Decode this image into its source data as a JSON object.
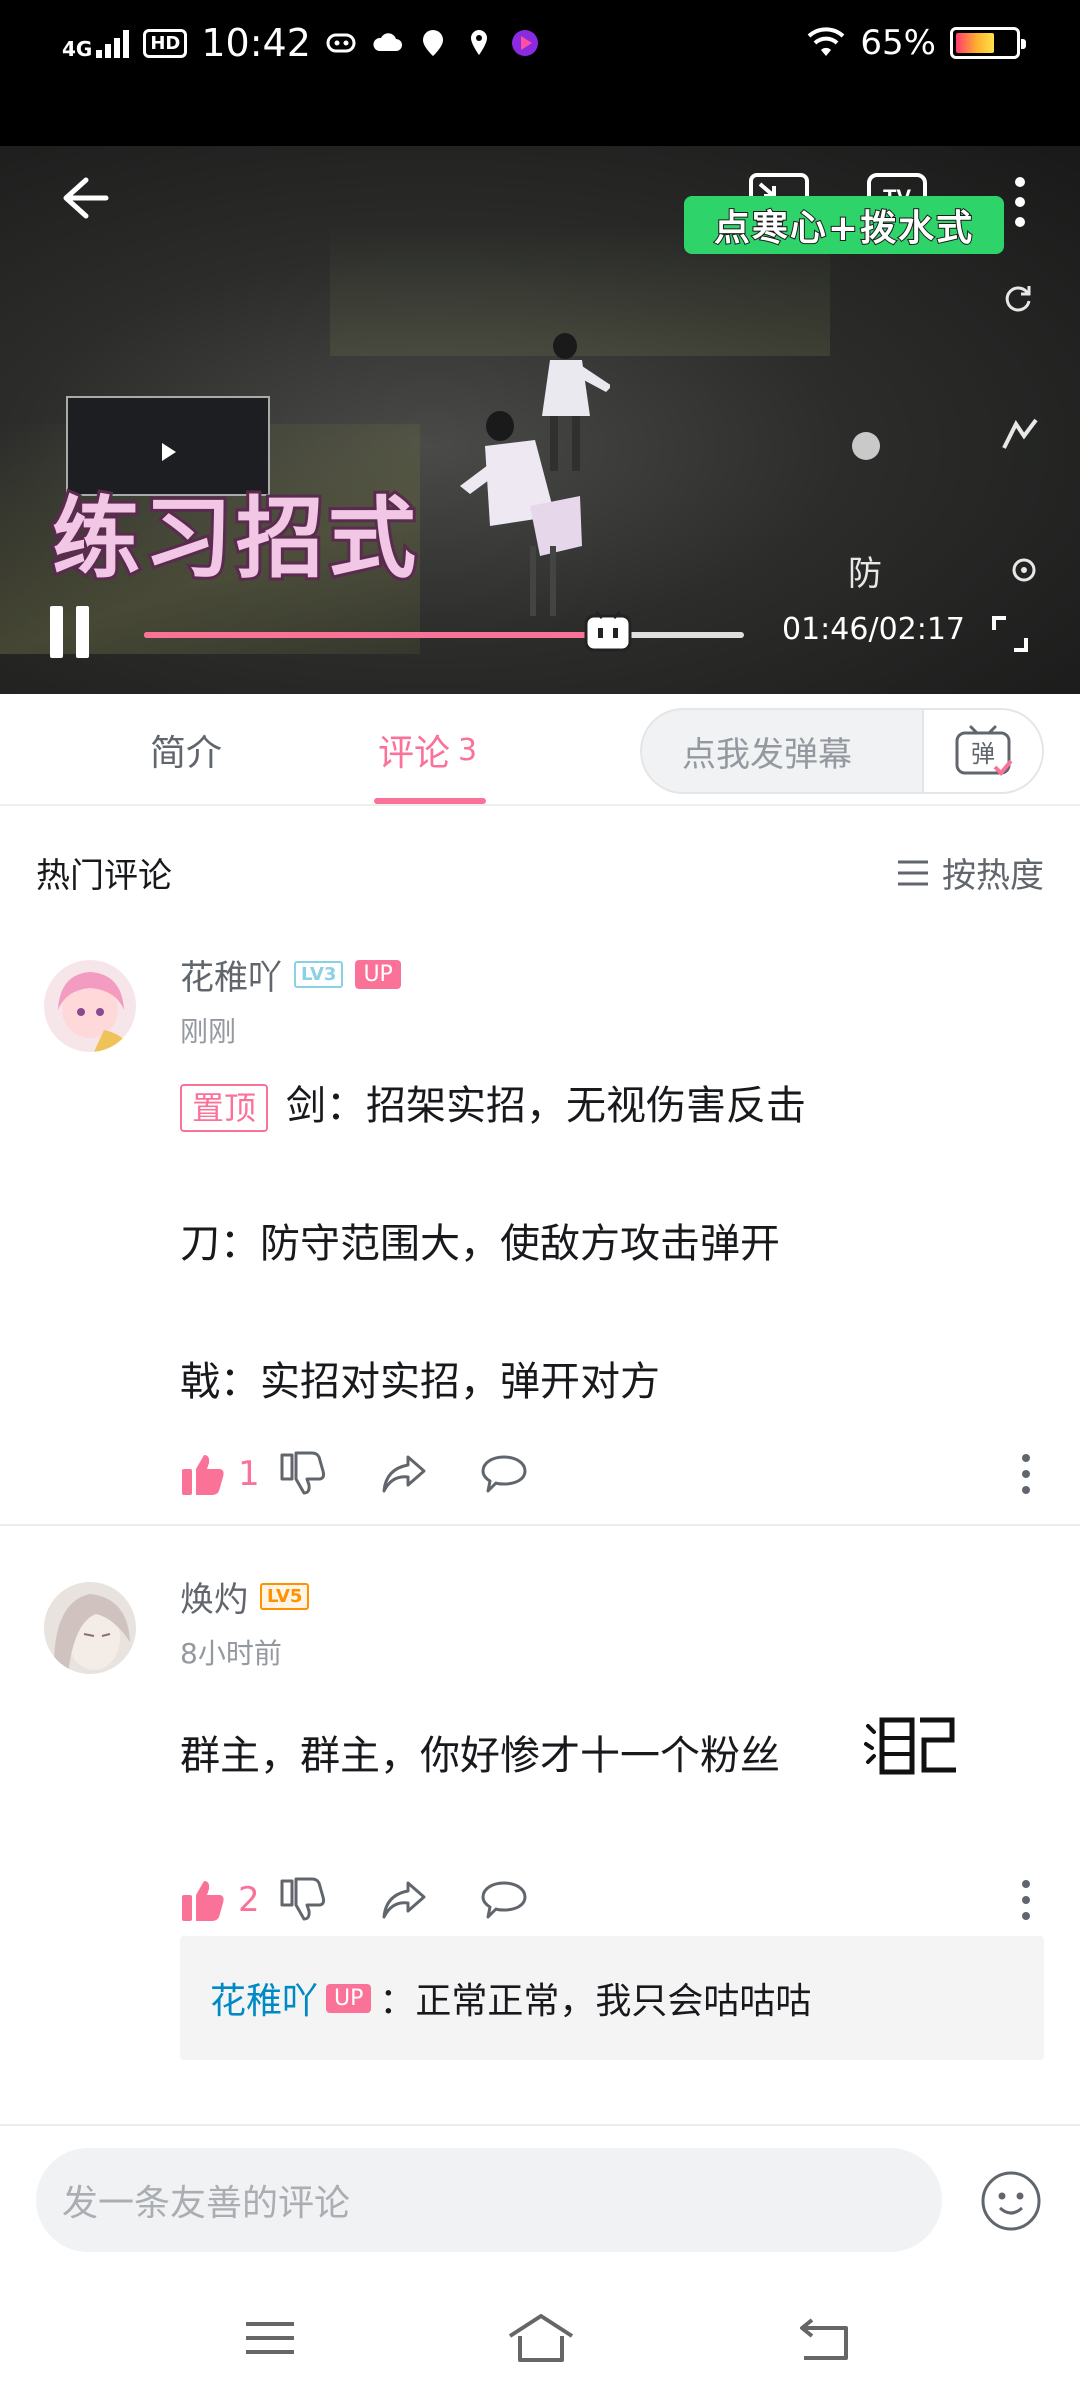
{
  "status_bar": {
    "network": "4G",
    "hd": "HD",
    "time": "10:42",
    "battery": "65%"
  },
  "video": {
    "top_hints": [
      "",
      "",
      "",
      "",
      ""
    ],
    "watermark": "",
    "green_caption": "点寒心+拨水式",
    "big_caption": "练习招式",
    "defense_glyph": "防",
    "time": "01:46/02:17",
    "progress": 0.7737
  },
  "tabs": {
    "intro": "简介",
    "comments": "评论",
    "comments_count": "3",
    "danmaku_placeholder": "点我发弹幕",
    "danmaku_btn": "弹"
  },
  "comments_header": {
    "title": "热门评论",
    "sort": "按热度"
  },
  "comments": [
    {
      "user": "花稚吖",
      "level": "LV3",
      "up": "UP",
      "time": "刚刚",
      "pin": "置顶",
      "lines": [
        "剑：招架实招，无视伤害反击",
        "刀：防守范围大，使敌方攻击弹开",
        "戟：实招对实招，弹开对方"
      ],
      "likes": "1"
    },
    {
      "user": "焕灼",
      "level": "LV5",
      "time": "8小时前",
      "text": "群主，群主，你好惨才十一个粉丝",
      "likes": "2",
      "reply": {
        "user": "花稚吖",
        "up": "UP",
        "text": "：正常正常，我只会咕咕咕"
      }
    }
  ],
  "bottom": {
    "placeholder": "发一条友善的评论"
  }
}
